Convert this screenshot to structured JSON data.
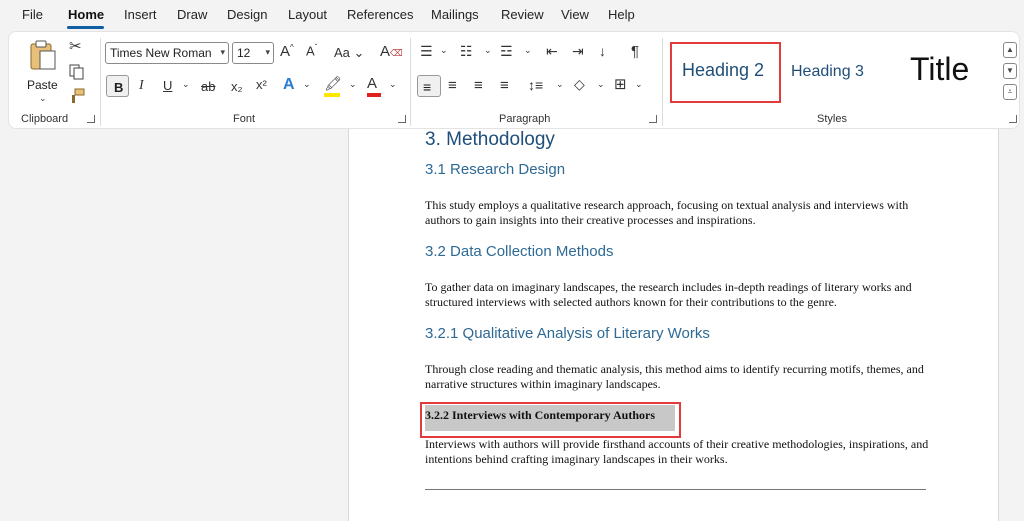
{
  "menu": {
    "file": "File",
    "home": "Home",
    "insert": "Insert",
    "draw": "Draw",
    "design": "Design",
    "layout": "Layout",
    "references": "References",
    "mailings": "Mailings",
    "review": "Review",
    "view": "View",
    "help": "Help"
  },
  "clipboard": {
    "paste_label": "Paste",
    "group_label": "Clipboard"
  },
  "font": {
    "family": "Times New Roman",
    "size": "12",
    "group_label": "Font",
    "bold": "B",
    "italic": "I",
    "underline": "U",
    "strike": "ab",
    "subscript": "x₂",
    "superscript": "x²",
    "aa": "Aa"
  },
  "paragraph": {
    "group_label": "Paragraph"
  },
  "styles": {
    "group_label": "Styles",
    "items": [
      "Heading 2",
      "Heading 3",
      "Title"
    ]
  },
  "document": {
    "h1": "3. Methodology",
    "s31_title": "3.1 Research Design",
    "s31_text": "This study employs a qualitative research approach, focusing on textual analysis and interviews with authors to gain insights into their creative processes and inspirations.",
    "s32_title": "3.2 Data Collection Methods",
    "s32_text": "To gather data on imaginary landscapes, the research includes in-depth readings of literary works and structured interviews with selected authors known for their contributions to the genre.",
    "s321_title": "3.2.1 Qualitative Analysis of Literary Works",
    "s321_text": "Through close reading and thematic analysis, this method aims to identify recurring motifs, themes, and narrative structures within imaginary landscapes.",
    "s322_title": "3.2.2 Interviews with Contemporary Authors",
    "s322_text": "Interviews with authors will provide firsthand accounts of their creative methodologies, inspirations, and intentions behind crafting imaginary landscapes in their works."
  },
  "colors": {
    "accent": "#115ea3",
    "heading": "#1f4e79",
    "highlight_box": "#e23b3b",
    "selection": "#c8c8c8"
  }
}
